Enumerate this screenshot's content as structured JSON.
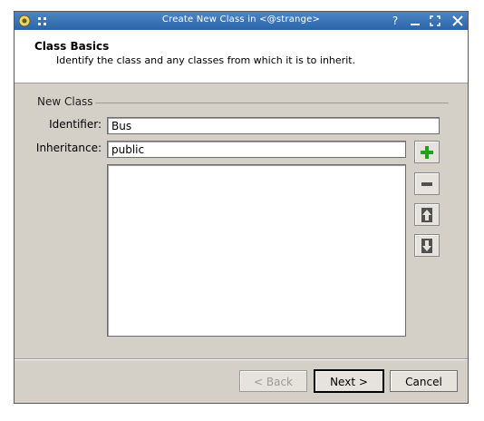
{
  "window": {
    "title": "Create New Class in  <@strange>",
    "help_glyph": "?",
    "minimize_glyph": "_",
    "maximize_glyph": "[ ]",
    "close_glyph": "✕"
  },
  "header": {
    "title": "Class Basics",
    "subtitle": "Identify the class and any classes from which it is to inherit."
  },
  "group": {
    "label": "New Class"
  },
  "form": {
    "identifier_label": "Identifier:",
    "identifier_value": "Bus",
    "inheritance_label": "Inheritance:",
    "inheritance_value": "public",
    "inherit_list": []
  },
  "side_buttons": {
    "add_icon": "plus-icon",
    "remove_icon": "minus-icon",
    "up_icon": "arrow-up-icon",
    "down_icon": "arrow-down-icon"
  },
  "footer": {
    "back_label": "< Back",
    "next_label": "Next >",
    "cancel_label": "Cancel"
  },
  "colors": {
    "title_bar": "#2c64a8",
    "dialog_bg": "#d4d0c8",
    "add_icon": "#22a022"
  }
}
